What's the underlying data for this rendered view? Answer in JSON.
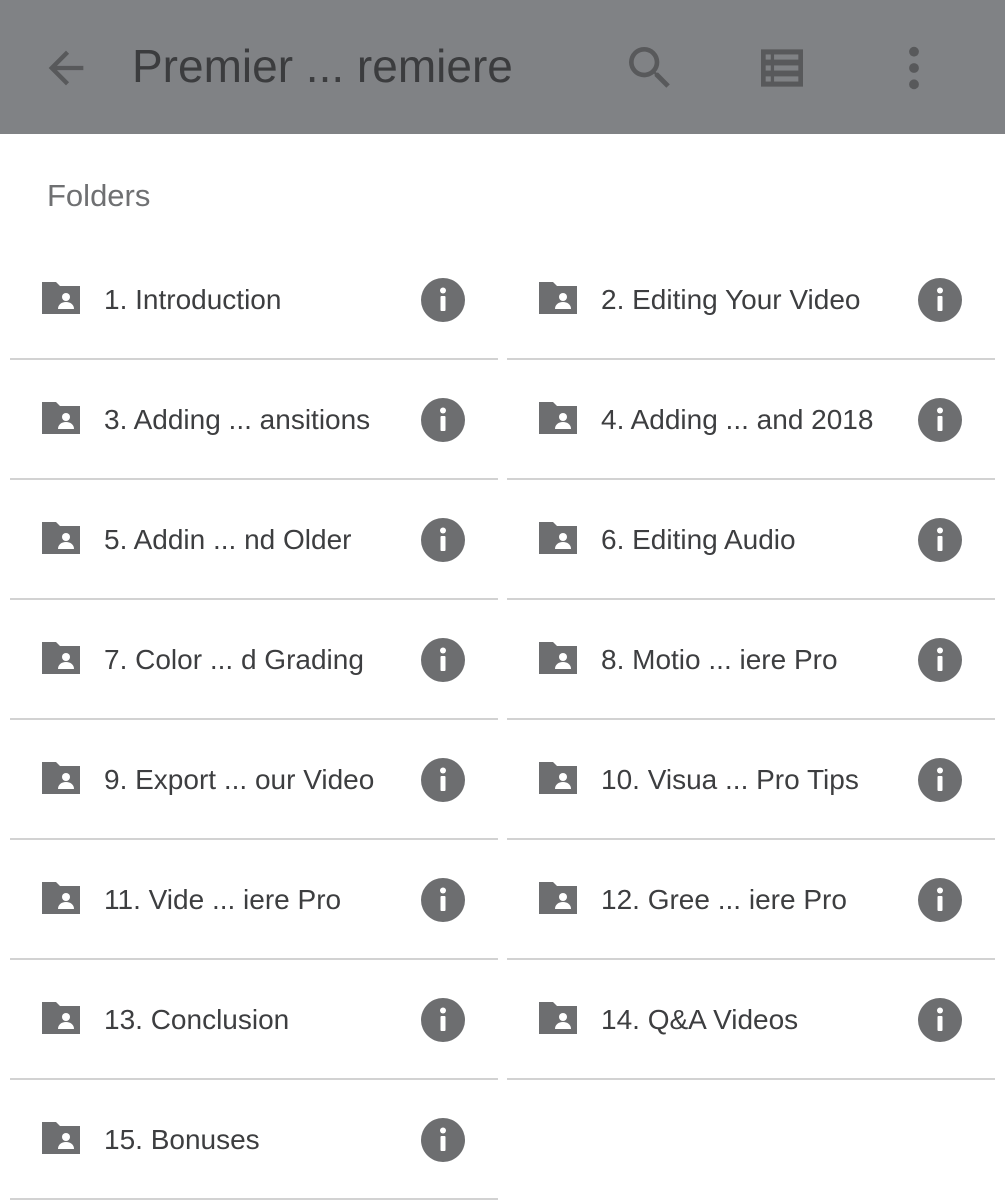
{
  "appbar": {
    "title": "Premier ... remiere",
    "icons": {
      "back": "arrow-back-icon",
      "search": "search-icon",
      "view": "list-view-icon",
      "more": "more-vert-icon"
    },
    "background_color": "#808285"
  },
  "section": {
    "label": "Folders"
  },
  "folders": [
    {
      "label": "1. Introduction"
    },
    {
      "label": "2. Editing Your Video"
    },
    {
      "label": "3. Adding ... ansitions"
    },
    {
      "label": "4. Adding ... and 2018"
    },
    {
      "label": "5. Addin ... nd Older"
    },
    {
      "label": "6. Editing Audio"
    },
    {
      "label": "7. Color ... d Grading"
    },
    {
      "label": "8. Motio ... iere Pro"
    },
    {
      "label": "9. Export ... our Video"
    },
    {
      "label": "10. Visua ... Pro Tips"
    },
    {
      "label": "11. Vide ... iere Pro"
    },
    {
      "label": "12. Gree ... iere Pro"
    },
    {
      "label": "13. Conclusion"
    },
    {
      "label": "14. Q&A Videos"
    },
    {
      "label": "15. Bonuses"
    }
  ],
  "colors": {
    "icon_gray": "#6d6e70",
    "divider": "#d2d2d2"
  }
}
